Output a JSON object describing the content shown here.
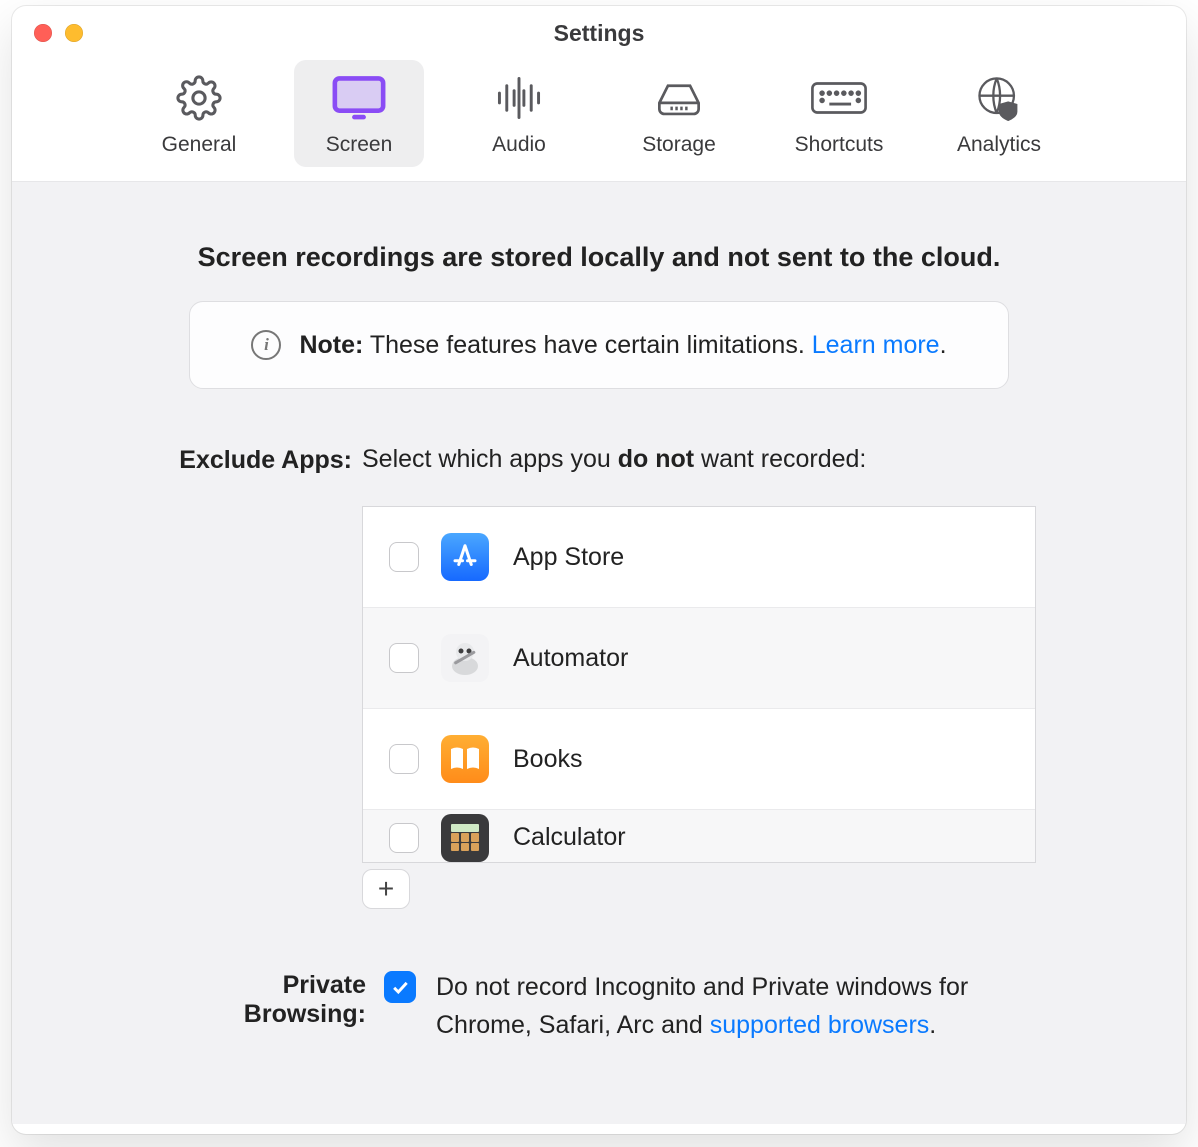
{
  "window": {
    "title": "Settings"
  },
  "tabs": {
    "general": {
      "label": "General"
    },
    "screen": {
      "label": "Screen",
      "selected": true
    },
    "audio": {
      "label": "Audio"
    },
    "storage": {
      "label": "Storage"
    },
    "shortcuts": {
      "label": "Shortcuts"
    },
    "analytics": {
      "label": "Analytics"
    }
  },
  "screen": {
    "headline": "Screen recordings are stored locally and not sent to the cloud.",
    "note": {
      "label": "Note:",
      "text": " These features have certain limitations. ",
      "link": "Learn more",
      "suffix": "."
    },
    "exclude": {
      "label": "Exclude Apps:",
      "prompt_pre": "Select which apps you ",
      "prompt_bold": "do not",
      "prompt_post": " want recorded:",
      "apps": [
        {
          "name": "App Store",
          "checked": false
        },
        {
          "name": "Automator",
          "checked": false
        },
        {
          "name": "Books",
          "checked": false
        },
        {
          "name": "Calculator",
          "checked": false
        }
      ],
      "add": "+"
    },
    "privateBrowsing": {
      "label": "Private Browsing:",
      "checked": true,
      "text_pre": "Do not record Incognito and Private windows for Chrome, Safari, Arc and ",
      "link": "supported browsers",
      "text_post": "."
    }
  }
}
